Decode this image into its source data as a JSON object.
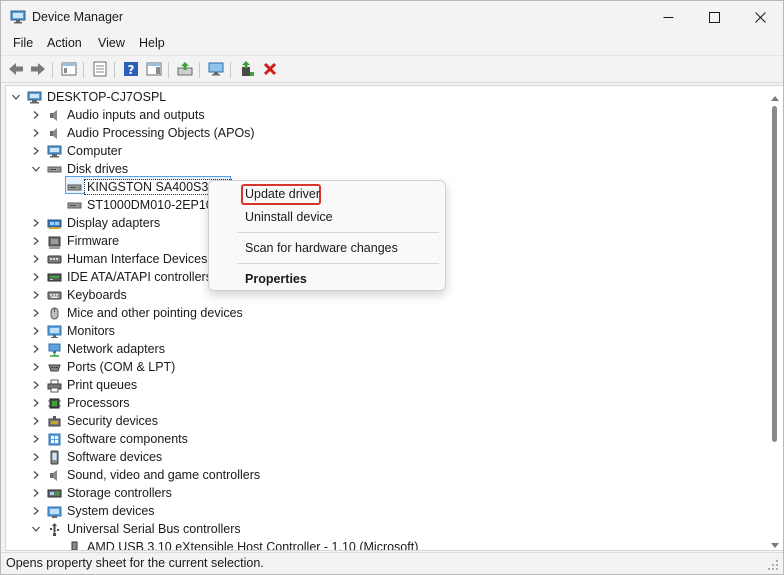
{
  "window": {
    "title": "Device Manager",
    "status": "Opens property sheet for the current selection."
  },
  "menu": [
    "File",
    "Action",
    "View",
    "Help"
  ],
  "tree": {
    "root": "DESKTOP-CJ7OSPL",
    "items": [
      {
        "label": "Audio inputs and outputs",
        "icon": "speaker-icon",
        "expanded": false
      },
      {
        "label": "Audio Processing Objects (APOs)",
        "icon": "speaker-icon",
        "expanded": false
      },
      {
        "label": "Computer",
        "icon": "computer-icon",
        "expanded": false
      },
      {
        "label": "Disk drives",
        "icon": "disk-drive-icon",
        "expanded": true
      },
      {
        "label": "KINGSTON SA400S3748",
        "icon": "disk-drive-icon",
        "child": true,
        "selected": true
      },
      {
        "label": "ST1000DM010-2EP102",
        "icon": "disk-drive-icon",
        "child": true
      },
      {
        "label": "Display adapters",
        "icon": "display-adapter-icon",
        "expanded": false
      },
      {
        "label": "Firmware",
        "icon": "firmware-icon",
        "expanded": false
      },
      {
        "label": "Human Interface Devices",
        "icon": "hid-icon",
        "expanded": false
      },
      {
        "label": "IDE ATA/ATAPI controllers",
        "icon": "ide-controller-icon",
        "expanded": false
      },
      {
        "label": "Keyboards",
        "icon": "keyboard-icon",
        "expanded": false
      },
      {
        "label": "Mice and other pointing devices",
        "icon": "mouse-icon",
        "expanded": false
      },
      {
        "label": "Monitors",
        "icon": "monitor-icon",
        "expanded": false
      },
      {
        "label": "Network adapters",
        "icon": "network-adapter-icon",
        "expanded": false
      },
      {
        "label": "Ports (COM & LPT)",
        "icon": "port-icon",
        "expanded": false
      },
      {
        "label": "Print queues",
        "icon": "printer-icon",
        "expanded": false
      },
      {
        "label": "Processors",
        "icon": "processor-icon",
        "expanded": false
      },
      {
        "label": "Security devices",
        "icon": "security-device-icon",
        "expanded": false
      },
      {
        "label": "Software components",
        "icon": "software-component-icon",
        "expanded": false
      },
      {
        "label": "Software devices",
        "icon": "software-device-icon",
        "expanded": false
      },
      {
        "label": "Sound, video and game controllers",
        "icon": "speaker-icon",
        "expanded": false
      },
      {
        "label": "Storage controllers",
        "icon": "storage-controller-icon",
        "expanded": false
      },
      {
        "label": "System devices",
        "icon": "system-device-icon",
        "expanded": false
      },
      {
        "label": "Universal Serial Bus controllers",
        "icon": "usb-icon",
        "expanded": true
      },
      {
        "label": "AMD USB 3.10 eXtensible Host Controller - 1.10 (Microsoft)",
        "icon": "usb-device-icon",
        "child": true
      }
    ]
  },
  "context_menu": {
    "update": "Update driver",
    "uninstall": "Uninstall device",
    "scan": "Scan for hardware changes",
    "properties": "Properties"
  },
  "colors": {
    "highlight": "#d9342b",
    "selection": "#e5f1fb"
  }
}
